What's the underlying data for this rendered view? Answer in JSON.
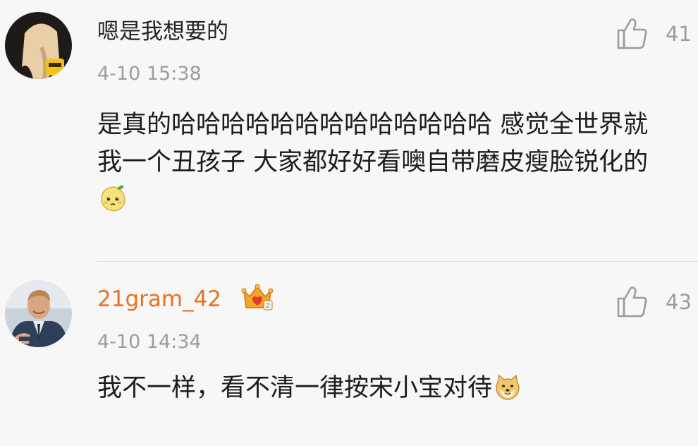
{
  "comments": [
    {
      "username": "嗯是我想要的",
      "timestamp": "4-10 15:38",
      "likes": "41",
      "text": "是真的哈哈哈哈哈哈哈哈哈哈哈哈哈 感觉全世界就我一个丑孩子 大家都好好看噢自带磨皮瘦脸锐化的",
      "emoji": "lemon-face-emoji"
    },
    {
      "username": "21gram_42",
      "badge": "vip-crown-badge",
      "timestamp": "4-10 14:34",
      "likes": "43",
      "text": "我不一样，看不清一律按宋小宝对待",
      "emoji": "doge-emoji"
    }
  ],
  "colors": {
    "background": "#f7f7f7",
    "vip_username": "#e8711e",
    "meta_gray": "#9c9c9c",
    "text": "#1c1c1c"
  }
}
